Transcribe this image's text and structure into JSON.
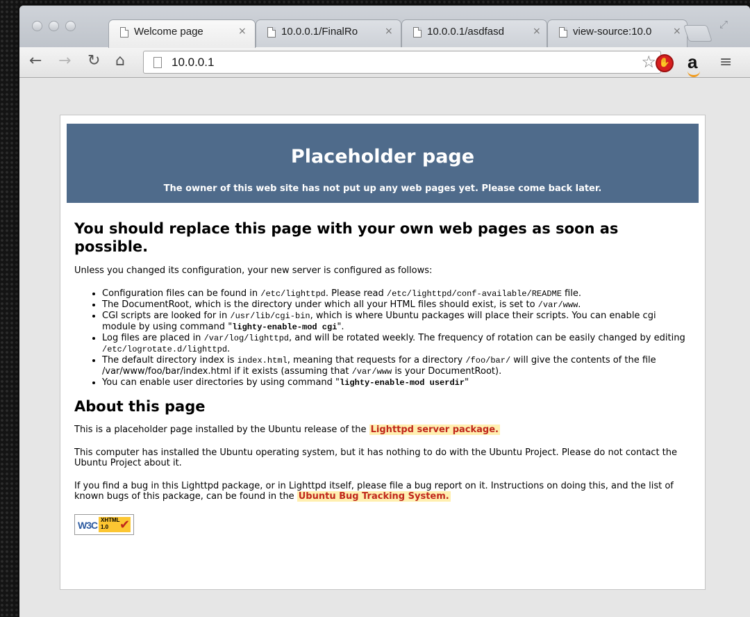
{
  "browser": {
    "tabs": [
      {
        "title": "Welcome page",
        "active": true
      },
      {
        "title": "10.0.0.1/FinalRo",
        "active": false
      },
      {
        "title": "10.0.0.1/asdfasd",
        "active": false
      },
      {
        "title": "view-source:10.0",
        "active": false
      }
    ],
    "tab_close_glyph": "×",
    "address": "10.0.0.1",
    "toolbar_icons": [
      "back-icon",
      "forward-icon",
      "reload-icon",
      "home-icon",
      "star-icon",
      "adblock-icon",
      "amazon-icon",
      "menu-icon"
    ],
    "amazon_label": "a"
  },
  "page": {
    "banner_title": "Placeholder page",
    "banner_subtitle": "The owner of this web site has not put up any web pages yet. Please come back later.",
    "main_heading": "You should replace this page with your own web pages as soon as possible.",
    "intro": "Unless you changed its configuration, your new server is configured as follows:",
    "config_items": {
      "item1": {
        "t1": "Configuration files can be found in ",
        "c1": "/etc/lighttpd",
        "t2": ". Please read ",
        "c2": "/etc/lighttpd/conf-available/README",
        "t3": " file."
      },
      "item2": {
        "t1": "The DocumentRoot, which is the directory under which all your HTML files should exist, is set to ",
        "c1": "/var/www",
        "t2": "."
      },
      "item3": {
        "t1": "CGI scripts are looked for in ",
        "c1": "/usr/lib/cgi-bin",
        "t2": ", which is where Ubuntu packages will place their scripts. You can enable cgi module by using command \"",
        "c2": "lighty-enable-mod cgi",
        "t3": "\"."
      },
      "item4": {
        "t1": "Log files are placed in ",
        "c1": "/var/log/lighttpd",
        "t2": ", and will be rotated weekly. The frequency of rotation can be easily changed by editing ",
        "c2": "/etc/logrotate.d/lighttpd",
        "t3": "."
      },
      "item5": {
        "t1": "The default directory index is ",
        "c1": "index.html",
        "t2": ", meaning that requests for a directory ",
        "c2": "/foo/bar/",
        "t3": " will give the contents of the file ",
        "c3": "/var/www/foo/bar/index.html",
        "t4": " if it exists (assuming that ",
        "c4": "/var/www",
        "t5": " is your DocumentRoot)."
      },
      "item6": {
        "t1": "You can enable user directories by using command \"",
        "c1": "lighty-enable-mod userdir",
        "t2": "\""
      }
    },
    "about_heading": "About this page",
    "about_p1_text": "This is a placeholder page installed by the Ubuntu release of the ",
    "about_p1_link": "Lighttpd server package.",
    "about_p2": "This computer has installed the Ubuntu operating system, but it has nothing to do with the Ubuntu Project. Please do not contact the Ubuntu Project about it.",
    "about_p3_text": "If you find a bug in this Lighttpd package, or in Lighttpd itself, please file a bug report on it. Instructions on doing this, and the list of known bugs of this package, can be found in the ",
    "about_p3_link": "Ubuntu Bug Tracking System.",
    "badge": {
      "w3c": "W3C",
      "line1": "XHTML",
      "line2": "1.0"
    }
  }
}
